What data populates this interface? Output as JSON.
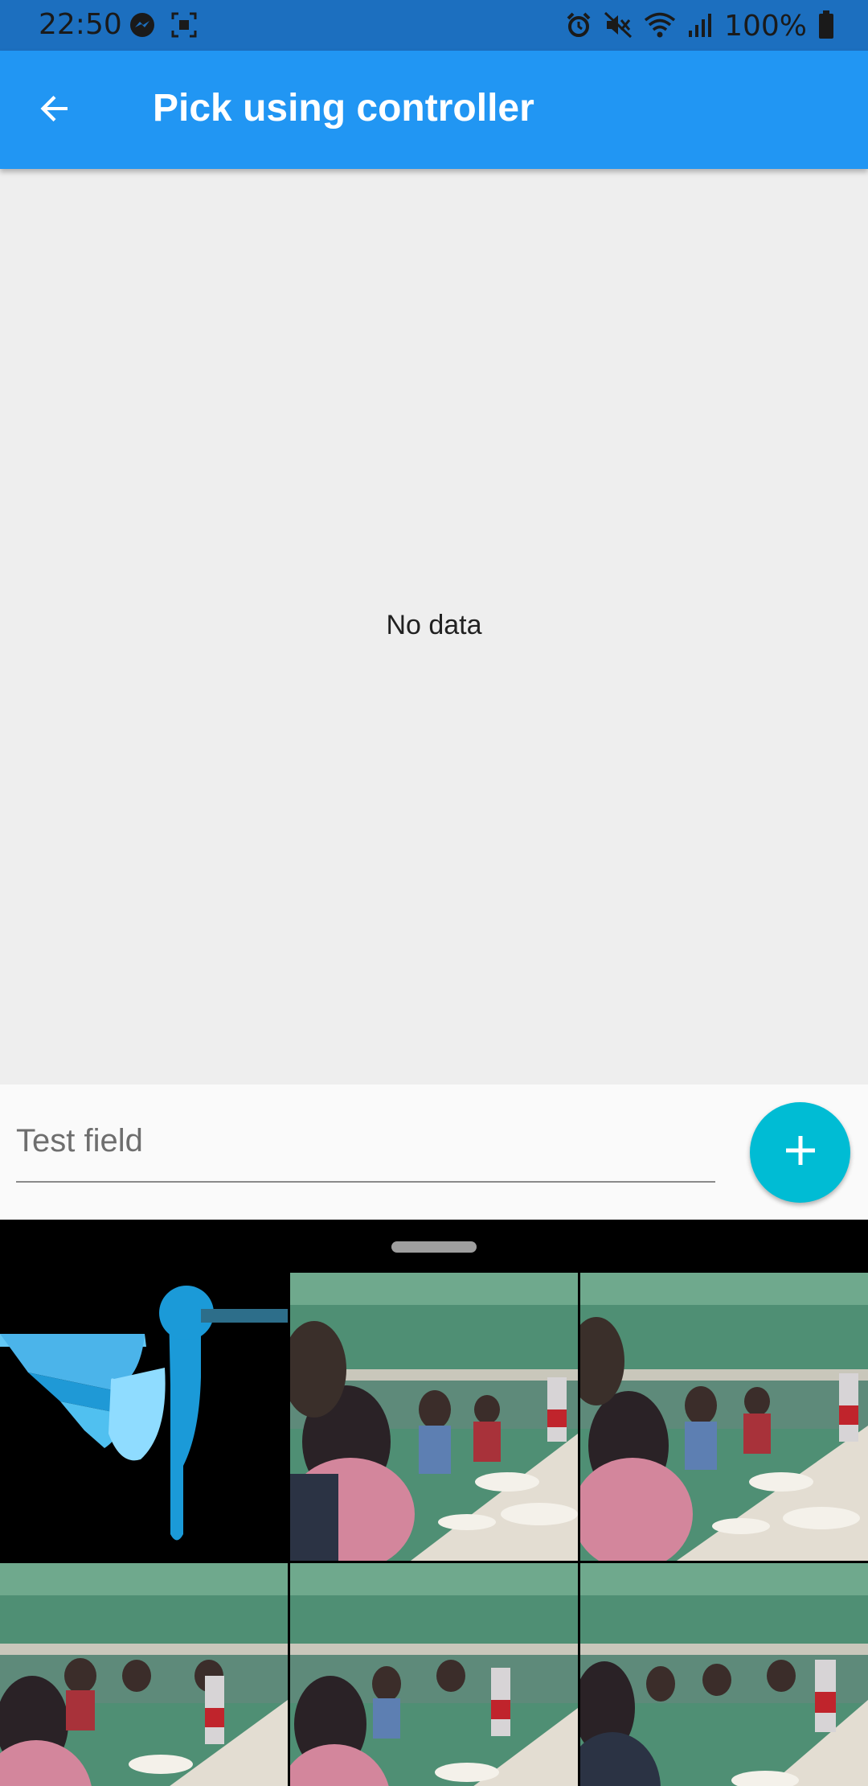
{
  "status_bar": {
    "time": "22:50",
    "battery": "100%",
    "left_icons": [
      "messenger-icon",
      "screenshot-icon"
    ],
    "right_icons": [
      "alarm-icon",
      "mute-icon",
      "wifi-icon",
      "signal-icon",
      "battery-icon"
    ]
  },
  "app_bar": {
    "title": "Pick using controller",
    "back_icon": "arrow-back-icon",
    "color": "#2196f3"
  },
  "content": {
    "empty_text": "No data"
  },
  "input": {
    "placeholder": "Test field",
    "value": ""
  },
  "fab": {
    "icon": "add-icon",
    "color": "#00bcd4"
  },
  "picker": {
    "items": [
      {
        "type": "logo",
        "name": "hummingbird-logo"
      },
      {
        "type": "photo",
        "name": "group-dinner-photo"
      },
      {
        "type": "photo",
        "name": "group-dinner-photo"
      },
      {
        "type": "photo",
        "name": "group-dinner-photo"
      },
      {
        "type": "photo",
        "name": "group-dinner-photo"
      },
      {
        "type": "photo",
        "name": "group-dinner-photo"
      }
    ]
  }
}
